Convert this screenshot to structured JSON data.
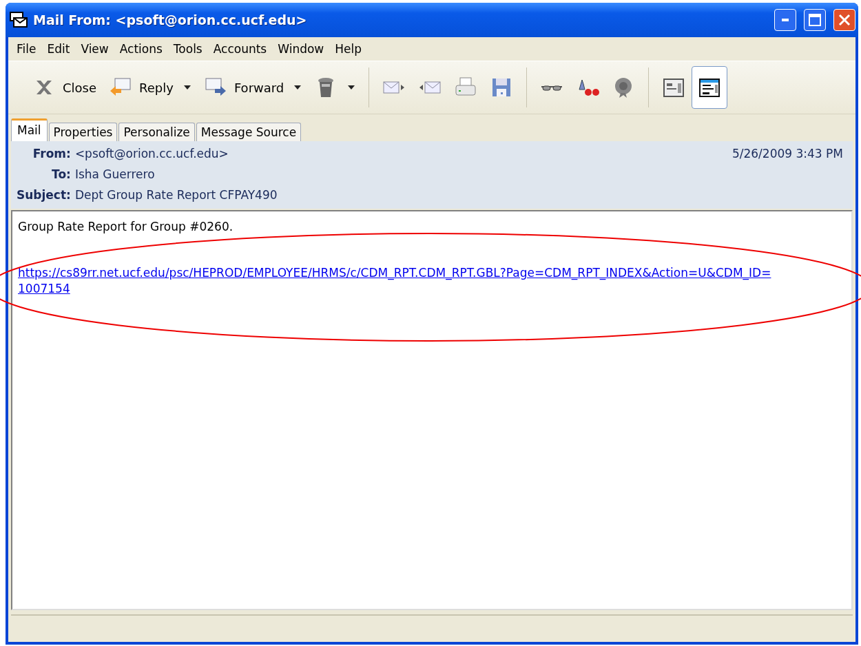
{
  "window": {
    "title": "Mail From: <psoft@orion.cc.ucf.edu>"
  },
  "menu": [
    "File",
    "Edit",
    "View",
    "Actions",
    "Tools",
    "Accounts",
    "Window",
    "Help"
  ],
  "toolbar": {
    "groups": [
      [
        {
          "label": "Close",
          "dropdown": false,
          "selected": false
        },
        {
          "label": "Reply",
          "dropdown": true,
          "selected": false
        },
        {
          "label": "Forward",
          "dropdown": true,
          "selected": false
        },
        {
          "dropdown": true,
          "selected": false
        }
      ],
      [
        {
          "dropdown": false,
          "selected": false
        },
        {
          "dropdown": false,
          "selected": false
        },
        {
          "dropdown": false,
          "selected": false
        },
        {
          "dropdown": false,
          "selected": false
        }
      ],
      [
        {
          "dropdown": false,
          "selected": false
        },
        {
          "dropdown": false,
          "selected": false
        },
        {
          "dropdown": false,
          "selected": false
        }
      ],
      [
        {
          "dropdown": false,
          "selected": false
        },
        {
          "dropdown": false,
          "selected": true
        }
      ]
    ]
  },
  "tabs": [
    {
      "label": "Mail",
      "selected": true
    },
    {
      "label": "Properties",
      "selected": false
    },
    {
      "label": "Personalize",
      "selected": false
    },
    {
      "label": "Message Source",
      "selected": false
    }
  ],
  "header": {
    "from_label": "From:",
    "from": "<psoft@orion.cc.ucf.edu>",
    "date": "5/26/2009 3:43 PM",
    "to_label": "To:",
    "to": "Isha Guerrero",
    "subject_label": "Subject:",
    "subject": "Dept Group Rate Report CFPAY490"
  },
  "body": {
    "text": "Group Rate Report for Group #0260.",
    "link_lines": [
      "https://cs89rr.net.ucf.edu/psc/HEPROD/EMPLOYEE/HRMS/c/CDM_RPT.CDM_RPT.GBL?Page=CDM_RPT_INDEX&Action=U&CDM_ID=",
      "1007154"
    ]
  },
  "annotation": {
    "kind": "ellipse"
  }
}
